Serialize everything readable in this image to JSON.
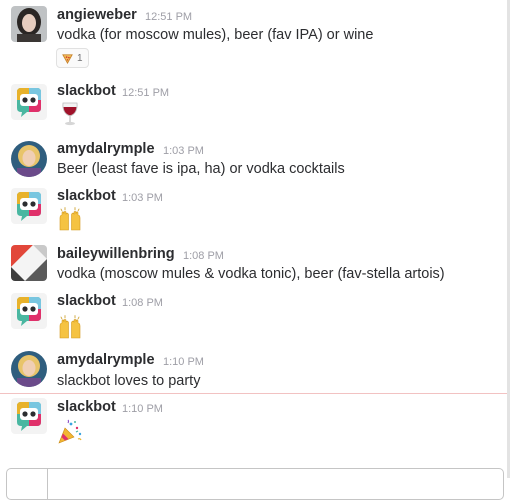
{
  "messages": [
    {
      "user": "angieweber",
      "time": "12:51 PM",
      "text": "vodka (for moscow mules), beer (fav IPA) or wine",
      "avatar": "photo-avatar",
      "reaction": {
        "emoji": "pizza-icon",
        "count": "1"
      }
    },
    {
      "user": "slackbot",
      "time": "12:51 PM",
      "emoji": "wine-glass-icon",
      "avatar": "slackbot-avatar"
    },
    {
      "user": "amydalrymple",
      "time": "1:03 PM",
      "text": "Beer (least fave is ipa, ha) or vodka cocktails",
      "avatar": "photo-avatar"
    },
    {
      "user": "slackbot",
      "time": "1:03 PM",
      "emoji": "raised-hands-icon",
      "avatar": "slackbot-avatar"
    },
    {
      "user": "baileywillenbring",
      "time": "1:08 PM",
      "text": "vodka (moscow mules & vodka tonic), beer (fav-stella artois)",
      "avatar": "geometric-avatar"
    },
    {
      "user": "slackbot",
      "time": "1:08 PM",
      "emoji": "raised-hands-icon",
      "avatar": "slackbot-avatar"
    },
    {
      "user": "amydalrymple",
      "time": "1:10 PM",
      "text": "slackbot loves to party",
      "avatar": "photo-avatar"
    },
    {
      "user": "slackbot",
      "time": "1:10 PM",
      "emoji": "party-popper-icon",
      "avatar": "slackbot-avatar"
    }
  ],
  "colors": {
    "username": "#2c2d30",
    "timestamp": "#9e9ea6",
    "new_message_divider": "#f2c2c2"
  }
}
